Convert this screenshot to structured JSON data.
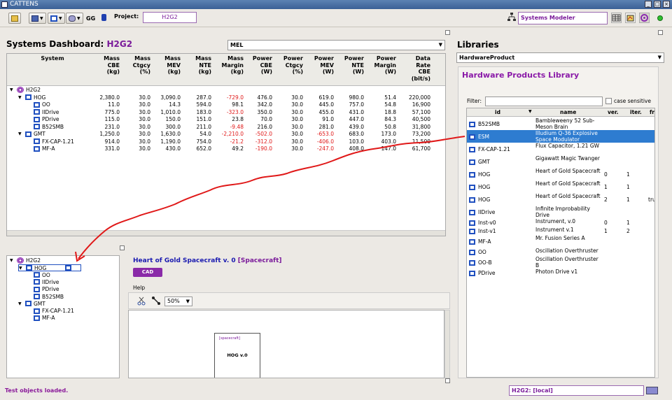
{
  "window": {
    "title": "CATTENS"
  },
  "toolbar": {
    "project_label": "Project:",
    "project_value": "H2G2",
    "gg_label": "GG",
    "modeler_value": "Systems Modeler"
  },
  "dashboard": {
    "title_prefix": "Systems Dashboard:",
    "title_project": "H2G2",
    "mel_select": "MEL",
    "columns": [
      "System",
      "Mass\nCBE\n(kg)",
      "Mass\nCtgcy\n(%)",
      "Mass\nMEV\n(kg)",
      "Mass\nNTE\n(kg)",
      "Mass\nMargin\n(kg)",
      "Power\nCBE\n(W)",
      "Power\nCtgcy\n(%)",
      "Power\nMEV\n(W)",
      "Power\nNTE\n(W)",
      "Power\nMargin\n(W)",
      "Data\nRate\nCBE\n(bit/s)"
    ],
    "rows": [
      {
        "name": "H2G2",
        "cells": [
          "",
          "",
          "",
          "",
          "",
          "",
          "",
          "",
          "",
          "",
          ""
        ]
      },
      {
        "name": "HOG",
        "cells": [
          "2,380.0",
          "30.0",
          "3,090.0",
          "287.0",
          "-729.0",
          "476.0",
          "30.0",
          "619.0",
          "980.0",
          "51.4",
          "220,000"
        ]
      },
      {
        "name": "OO",
        "cells": [
          "11.0",
          "30.0",
          "14.3",
          "594.0",
          "98.1",
          "342.0",
          "30.0",
          "445.0",
          "757.0",
          "54.8",
          "16,900"
        ]
      },
      {
        "name": "IIDrive",
        "cells": [
          "775.0",
          "30.0",
          "1,010.0",
          "183.0",
          "-323.0",
          "350.0",
          "30.0",
          "455.0",
          "431.0",
          "18.8",
          "57,100"
        ]
      },
      {
        "name": "PDrive",
        "cells": [
          "115.0",
          "30.0",
          "150.0",
          "151.0",
          "23.8",
          "70.0",
          "30.0",
          "91.0",
          "447.0",
          "84.3",
          "40,500"
        ]
      },
      {
        "name": "B52SMB",
        "cells": [
          "231.0",
          "30.0",
          "300.0",
          "211.0",
          "-9.48",
          "216.0",
          "30.0",
          "281.0",
          "439.0",
          "50.8",
          "31,800"
        ]
      },
      {
        "name": "GMT",
        "cells": [
          "1,250.0",
          "30.0",
          "1,630.0",
          "54.0",
          "-2,210.0",
          "-502.0",
          "30.0",
          "-653.0",
          "683.0",
          "173.0",
          "73,200"
        ]
      },
      {
        "name": "FX-CAP-1.21",
        "cells": [
          "914.0",
          "30.0",
          "1,190.0",
          "754.0",
          "-21.2",
          "-312.0",
          "30.0",
          "-406.0",
          "103.0",
          "403.0",
          "11,500"
        ]
      },
      {
        "name": "MF-A",
        "cells": [
          "331.0",
          "30.0",
          "430.0",
          "652.0",
          "49.2",
          "-190.0",
          "30.0",
          "-247.0",
          "408.0",
          "147.0",
          "61,700"
        ]
      }
    ]
  },
  "tree": {
    "nodes": [
      "H2G2",
      "HOG",
      "OO",
      "IIDrive",
      "PDrive",
      "B52SMB",
      "GMT",
      "FX-CAP-1.21",
      "MF-A"
    ]
  },
  "object": {
    "title": "Heart of Gold Spacecraft v. 0",
    "kind": "[Spacecraft]",
    "cad_label": "CAD",
    "help_label": "Help",
    "zoom": "50%",
    "diagram_stereotype": "[spacecraft]",
    "diagram_name": "HOG v.0"
  },
  "status": {
    "message": "Test objects loaded.",
    "repo": "H2G2: [local]"
  },
  "libraries": {
    "title": "Libraries",
    "select": "HardwareProduct",
    "heading": "Hardware Products Library",
    "filter_label": "Filter:",
    "case_label": "case sensitive",
    "columns": [
      "id",
      "name",
      "ver.",
      "iter.",
      "fr"
    ],
    "rows": [
      {
        "id": "B52SMB",
        "name": "Bambleweeny 52 Sub-Meson Brain",
        "ver": "",
        "iter": "",
        "fr": ""
      },
      {
        "id": "ESM",
        "name": "Illudium Q-36 Explosive Space Modulator",
        "ver": "",
        "iter": "",
        "fr": ""
      },
      {
        "id": "FX-CAP-1.21",
        "name": "Flux Capacitor, 1.21 GW",
        "ver": "",
        "iter": "",
        "fr": ""
      },
      {
        "id": "GMT",
        "name": "Gigawatt Magic Twanger",
        "ver": "",
        "iter": "",
        "fr": ""
      },
      {
        "id": "HOG",
        "name": "Heart of Gold Spacecraft",
        "ver": "0",
        "iter": "1",
        "fr": ""
      },
      {
        "id": "HOG",
        "name": "Heart of Gold Spacecraft",
        "ver": "1",
        "iter": "1",
        "fr": ""
      },
      {
        "id": "HOG",
        "name": "Heart of Gold Spacecraft",
        "ver": "2",
        "iter": "1",
        "fr": "tru"
      },
      {
        "id": "IIDrive",
        "name": "Infinite Improbability Drive",
        "ver": "",
        "iter": "",
        "fr": ""
      },
      {
        "id": "Inst-v0",
        "name": "Instrument, v.0",
        "ver": "0",
        "iter": "1",
        "fr": ""
      },
      {
        "id": "Inst-v1",
        "name": "Instrument v.1",
        "ver": "1",
        "iter": "2",
        "fr": ""
      },
      {
        "id": "MF-A",
        "name": "Mr. Fusion Series A",
        "ver": "",
        "iter": "",
        "fr": ""
      },
      {
        "id": "OO",
        "name": "Oscillation Overthruster",
        "ver": "",
        "iter": "",
        "fr": ""
      },
      {
        "id": "OO-B",
        "name": "Oscillation Overthruster B",
        "ver": "",
        "iter": "",
        "fr": ""
      },
      {
        "id": "PDrive",
        "name": "Photon Drive v1",
        "ver": "",
        "iter": "",
        "fr": ""
      }
    ]
  }
}
